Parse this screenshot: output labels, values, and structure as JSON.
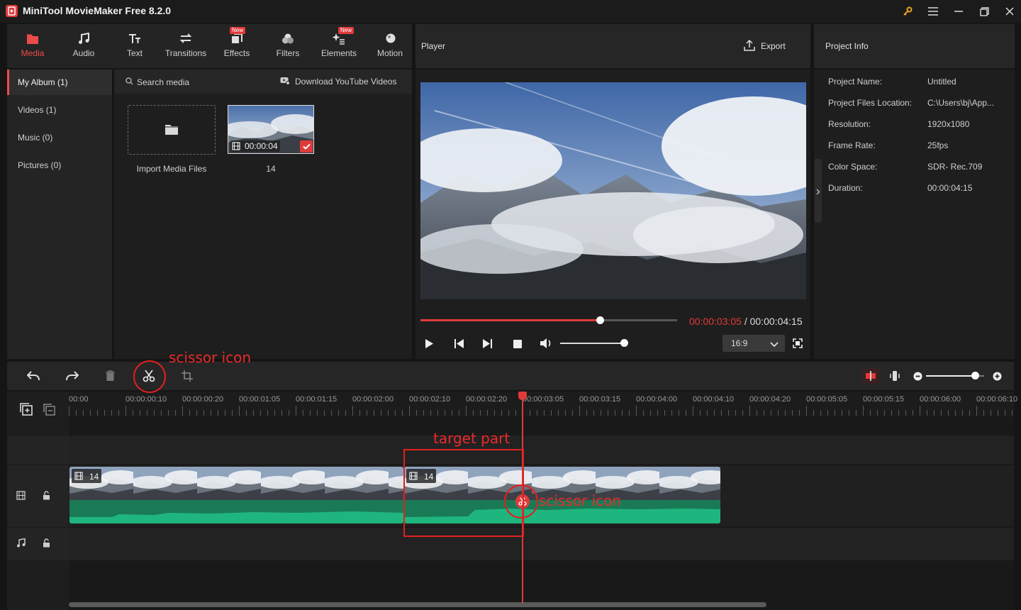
{
  "app": {
    "title": "MiniTool MovieMaker Free 8.2.0"
  },
  "toolbar": {
    "items": [
      {
        "label": "Media",
        "active": true
      },
      {
        "label": "Audio"
      },
      {
        "label": "Text"
      },
      {
        "label": "Transitions"
      },
      {
        "label": "Effects",
        "badge": "New"
      },
      {
        "label": "Filters"
      },
      {
        "label": "Elements",
        "badge": "New"
      },
      {
        "label": "Motion"
      }
    ]
  },
  "album": {
    "items": [
      {
        "label": "My Album (1)"
      },
      {
        "label": "Videos (1)"
      },
      {
        "label": "Music (0)"
      },
      {
        "label": "Pictures (0)"
      }
    ]
  },
  "media": {
    "search_placeholder": "Search media",
    "download_label": "Download YouTube Videos",
    "import_label": "Import Media Files",
    "clip_name": "14",
    "clip_duration": "00:00:04"
  },
  "player": {
    "title": "Player",
    "export_label": "Export",
    "current_time": "00:00:03:05",
    "separator": " / ",
    "total_time": "00:00:04:15",
    "progress": 0.7,
    "volume": 0.95,
    "aspect_ratio": "16:9"
  },
  "project_info": {
    "title": "Project Info",
    "rows": [
      {
        "label": "Project Name:",
        "value": "Untitled"
      },
      {
        "label": "Project Files Location:",
        "value": "C:\\Users\\bj\\App..."
      },
      {
        "label": "Resolution:",
        "value": "1920x1080"
      },
      {
        "label": "Frame Rate:",
        "value": "25fps"
      },
      {
        "label": "Color Space:",
        "value": "SDR- Rec.709"
      },
      {
        "label": "Duration:",
        "value": "00:00:04:15"
      }
    ]
  },
  "timeline": {
    "ticks": [
      "00:00",
      "00:00:00:10",
      "00:00:00:20",
      "00:00:01:05",
      "00:00:01:15",
      "00:00:02:00",
      "00:00:02:10",
      "00:00:02:20",
      "00:00:03:05",
      "00:00:03:15",
      "00:00:04:00",
      "00:00:04:10",
      "00:00:04:20",
      "00:00:05:05",
      "00:00:05:15",
      "00:00:06:00",
      "00:00:06:10"
    ],
    "clip1_label": "14",
    "clip2_label": "14",
    "zoom_level": 0.85
  },
  "annotations": {
    "toolbar_scissor": "scissor icon",
    "target": "target part",
    "playhead_scissor": "scissor icon"
  },
  "colors": {
    "accent": "#ec4b4b",
    "audio": "#1fb57e",
    "audio_dark": "#1a7a56"
  }
}
